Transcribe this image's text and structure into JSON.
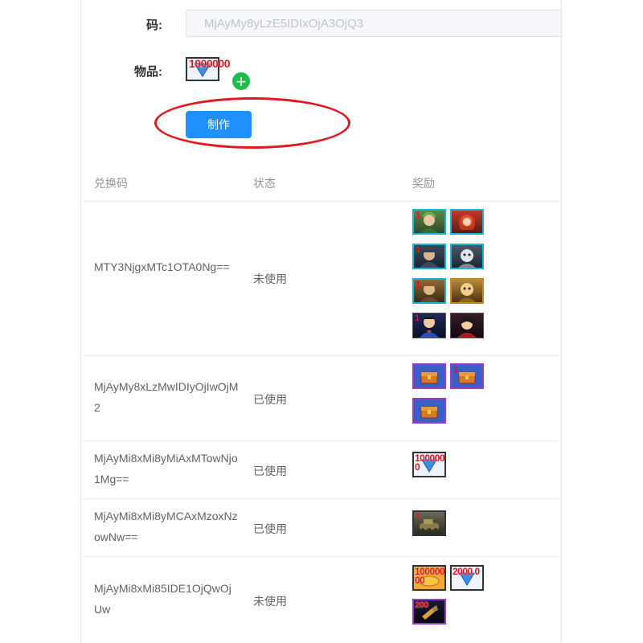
{
  "form": {
    "code_label": "码:",
    "code_value": "MjAyMy8yLzE5IDIxOjA3OjQ3",
    "item_label": "物品:",
    "item_quantity": "1000000",
    "add_icon": "plus-circle-icon",
    "make_button": "制作"
  },
  "table": {
    "headers": [
      "兑换码",
      "状态",
      "奖励"
    ],
    "rows": [
      {
        "code": "MTY3NjgxMTc1OTA0Ng==",
        "status": "未使用",
        "reward_count": 8
      },
      {
        "code": "MjAyMy8xLzMwIDIyOjIwOjM2",
        "status": "已使用",
        "reward_count": 3
      },
      {
        "code": "MjAyMi8xMi8yMiAxMTowNjo1Mg==",
        "status": "已使用",
        "reward_count": 1,
        "reward_quantity": "1000000"
      },
      {
        "code": "MjAyMi8xMi8yMCAxMzoxNzowNw==",
        "status": "已使用",
        "reward_count": 1
      },
      {
        "code": "MjAyMi8xMi85IDE1OjQwOjUw",
        "status": "未使用",
        "reward_count": 3,
        "reward_quantities": [
          "10000000",
          "2000.0",
          "200"
        ]
      }
    ]
  },
  "colors": {
    "primary": "#1e90ff",
    "highlight_ring": "#e1181d",
    "add_green": "#1dbd4a",
    "quantity_red": "#e8121b"
  }
}
